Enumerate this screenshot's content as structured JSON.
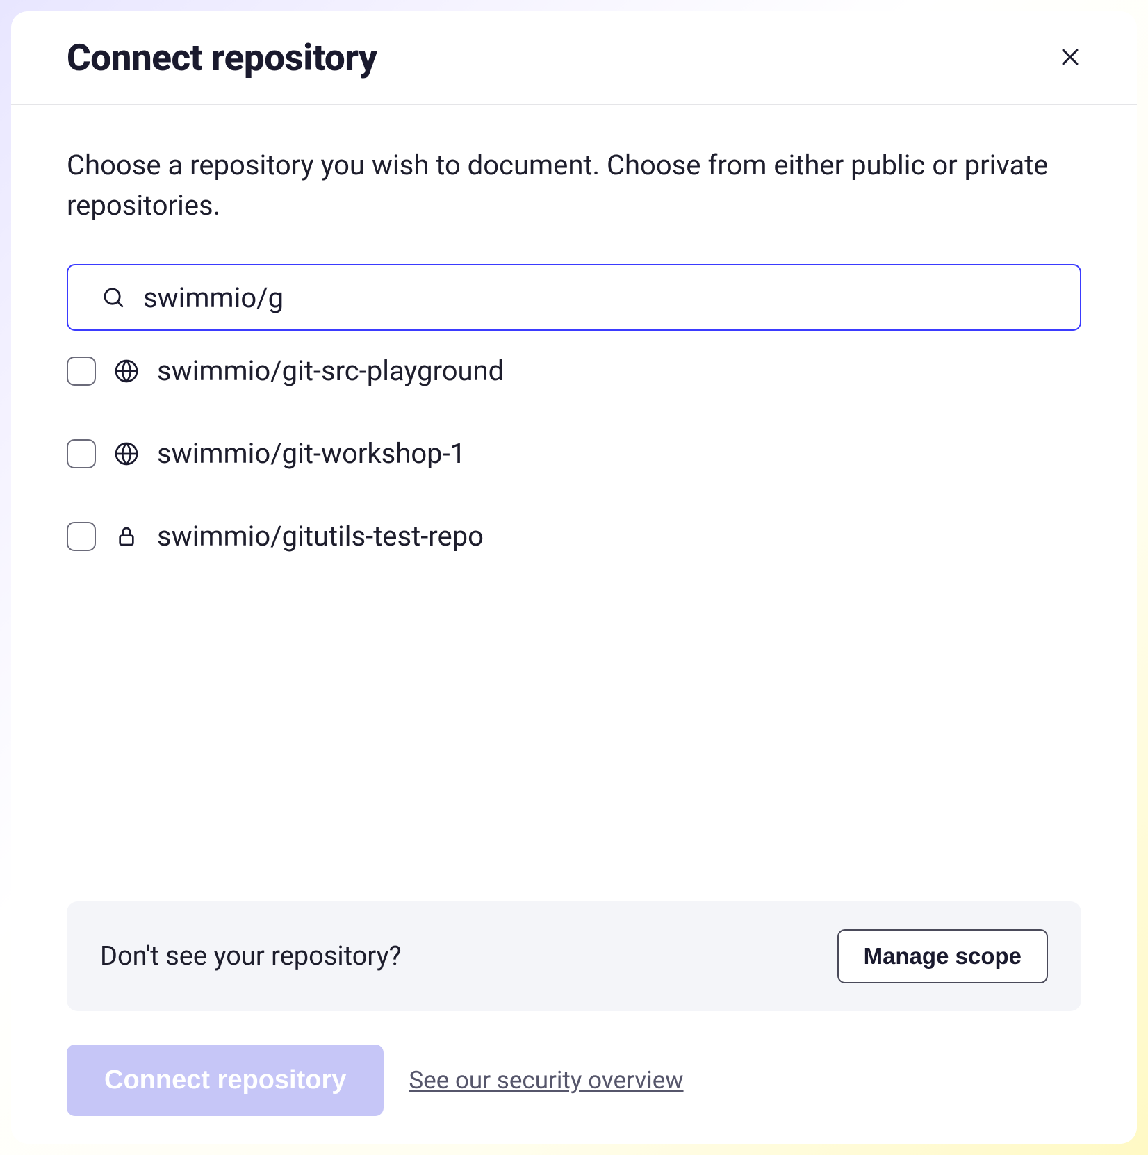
{
  "header": {
    "title": "Connect repository"
  },
  "body": {
    "description": "Choose a repository you wish to document. Choose from either public or private repositories.",
    "search_value": "swimmio/g"
  },
  "repos": [
    {
      "name": "swimmio/git-src-playground",
      "visibility": "public",
      "icon": "globe-icon"
    },
    {
      "name": "swimmio/git-workshop-1",
      "visibility": "public",
      "icon": "globe-icon"
    },
    {
      "name": "swimmio/gitutils-test-repo",
      "visibility": "private",
      "icon": "lock-icon"
    }
  ],
  "hint": {
    "text": "Don't see your repository?",
    "button": "Manage scope"
  },
  "footer": {
    "connect_button": "Connect repository",
    "security_link": "See our security overview"
  }
}
